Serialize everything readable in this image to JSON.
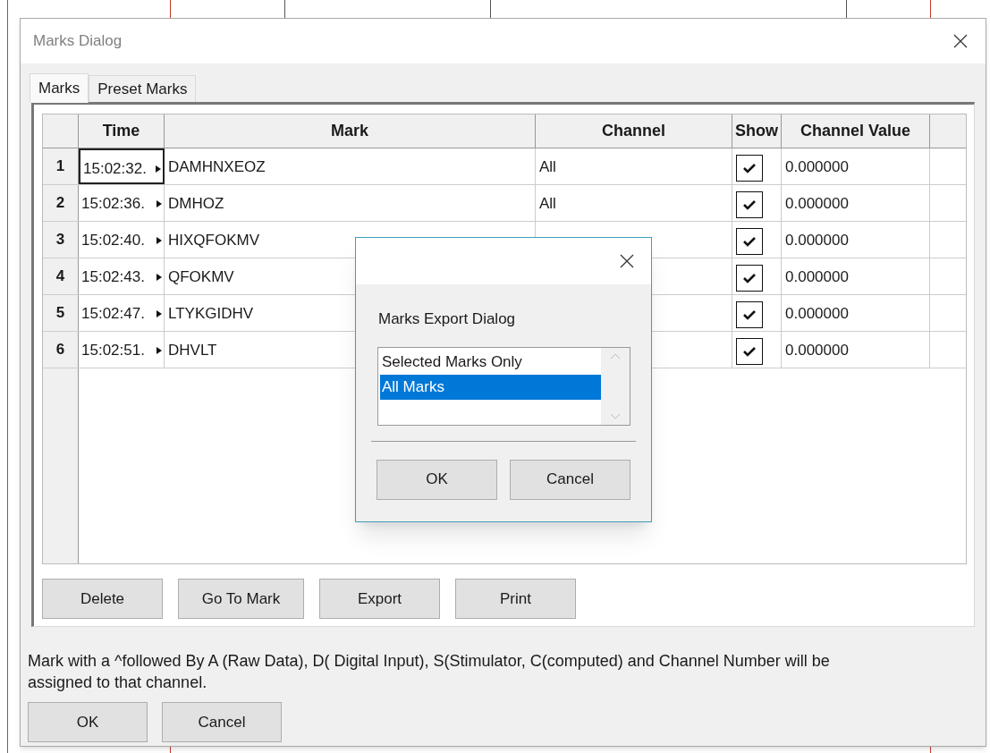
{
  "window": {
    "title": "Marks Dialog"
  },
  "tabs": [
    {
      "label": "Marks",
      "selected": true
    },
    {
      "label": "Preset Marks",
      "selected": false
    }
  ],
  "table": {
    "columns": [
      "Time",
      "Mark",
      "Channel",
      "Show",
      "Channel Value"
    ],
    "rows": [
      {
        "number": "1",
        "time": "15:02:32.",
        "mark": "DAMHNXEOZ",
        "channel": "All",
        "show": true,
        "value": "0.000000",
        "selected": true
      },
      {
        "number": "2",
        "time": "15:02:36.",
        "mark": "DMHOZ",
        "channel": "All",
        "show": true,
        "value": "0.000000",
        "selected": false
      },
      {
        "number": "3",
        "time": "15:02:40.",
        "mark": "HIXQFOKMV",
        "show": true,
        "value": "0.000000",
        "selected": false
      },
      {
        "number": "4",
        "time": "15:02:43.",
        "mark": "QFOKMV",
        "show": true,
        "value": "0.000000",
        "selected": false
      },
      {
        "number": "5",
        "time": "15:02:47.",
        "mark": "LTYKGIDHV",
        "show": true,
        "value": "0.000000",
        "selected": false
      },
      {
        "number": "6",
        "time": "15:02:51.",
        "mark": "DHVLT",
        "show": true,
        "value": "0.000000",
        "selected": false
      }
    ]
  },
  "panel_buttons": [
    "Delete",
    "Go To Mark",
    "Export",
    "Print"
  ],
  "note": "Mark with a ^followed By A (Raw Data), D( Digital Input), S(Stimulator, C(computed) and Channel Number will be assigned to that channel.",
  "buttons": [
    "OK",
    "Cancel"
  ],
  "export_dialog": {
    "label": "Marks Export Dialog",
    "options": [
      {
        "label": "Selected Marks Only",
        "selected": false
      },
      {
        "label": "All Marks",
        "selected": true
      }
    ],
    "buttons": [
      "OK",
      "Cancel"
    ]
  }
}
